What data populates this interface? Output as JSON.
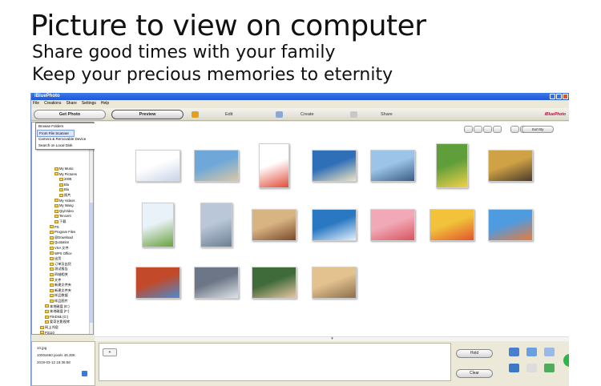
{
  "promo": {
    "title": "Picture to view on computer",
    "line1": "Share good times with your family",
    "line2": "Keep your precious memories to eternity"
  },
  "window": {
    "title": "iBluePhoto",
    "menu": [
      "File",
      "Creations",
      "Share",
      "Settings",
      "Help"
    ]
  },
  "toolbar": {
    "get_photo": "Get Photo",
    "preview": "Preview",
    "edit": "Edit",
    "create": "Create",
    "share": "Share"
  },
  "get_photo_menu": {
    "browse_folders": "Browse Folders",
    "from_file_scanner": "From File Scanner",
    "camera_removable": "Camera & Removable Device",
    "search_local_disk": "Search on Local Disk"
  },
  "folder_tree": [
    "My Music",
    "My Pictures",
    "2008",
    "Blu",
    "Blu",
    "照片",
    "My Videos",
    "My Wang",
    "QiyiVideo",
    "Tencent",
    "下载",
    "PS",
    "Program Files",
    "@Download",
    "Quotation",
    "VSA 文件",
    "WPS Office",
    "出货",
    "订单及出货",
    "测试报告",
    "四轴相关",
    "文件",
    "新建文件夹",
    "新建文件夹",
    "样品数据",
    "样品图片",
    "本地磁盘 (E:)",
    "本地磁盘 (F:)",
    "FileDisk (G:)",
    "爱奇艺影视库",
    "网上邻居",
    "P3110"
  ],
  "view": {
    "sort_by": "Sort By"
  },
  "thumbnails": [
    "colorful-dice",
    "seaside-boat",
    "girl-santa-hat",
    "island-sea",
    "beach-umbrellas",
    "child-in-garden",
    "child-flower-hat",
    "tree-on-field",
    "city-skyscrapers",
    "teddy-bears",
    "clouds-sea",
    "peaches",
    "fruit-plate",
    "kids-pool",
    "red-tree-sky",
    "waves-rocks",
    "little-girl",
    "sunset-sea"
  ],
  "info": {
    "filename": "10.jpg",
    "dimensions": "1000x660 pixels 46.30K",
    "date": "2019-03-12 16:36:58"
  },
  "actions": {
    "hold": "Hold",
    "clear": "Clear"
  }
}
